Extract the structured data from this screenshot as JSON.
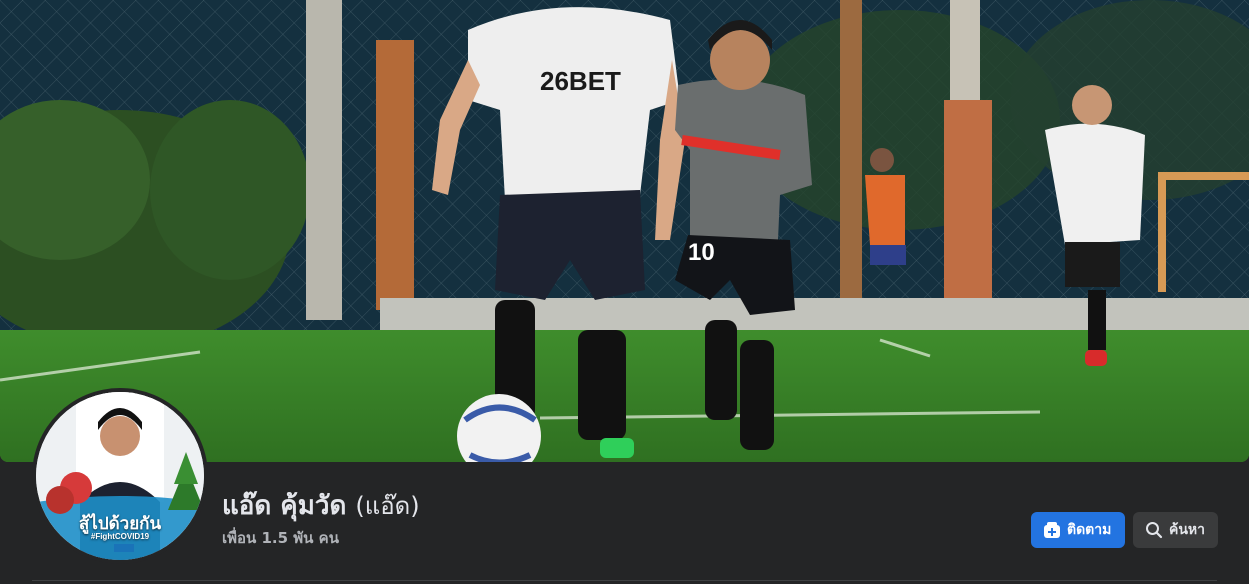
{
  "profile": {
    "name": "แอ๊ด คุ้มวัด",
    "alternate_name": "(แอ๊ด)",
    "friends_label": "เพื่อน 1.5 พัน คน",
    "avatar_frame_title": "สู้ไปด้วยกัน",
    "avatar_frame_tag": "#FightCOVID19"
  },
  "actions": {
    "follow_label": "ติดตาม",
    "follow_icon": "follow-plus-icon",
    "search_label": "ค้นหา",
    "search_icon": "search-icon"
  },
  "colors": {
    "background": "#242526",
    "primary_button": "#2374e1",
    "secondary_button": "#3a3b3c",
    "text_primary": "#e4e6eb",
    "text_secondary": "#b0b3b8"
  }
}
